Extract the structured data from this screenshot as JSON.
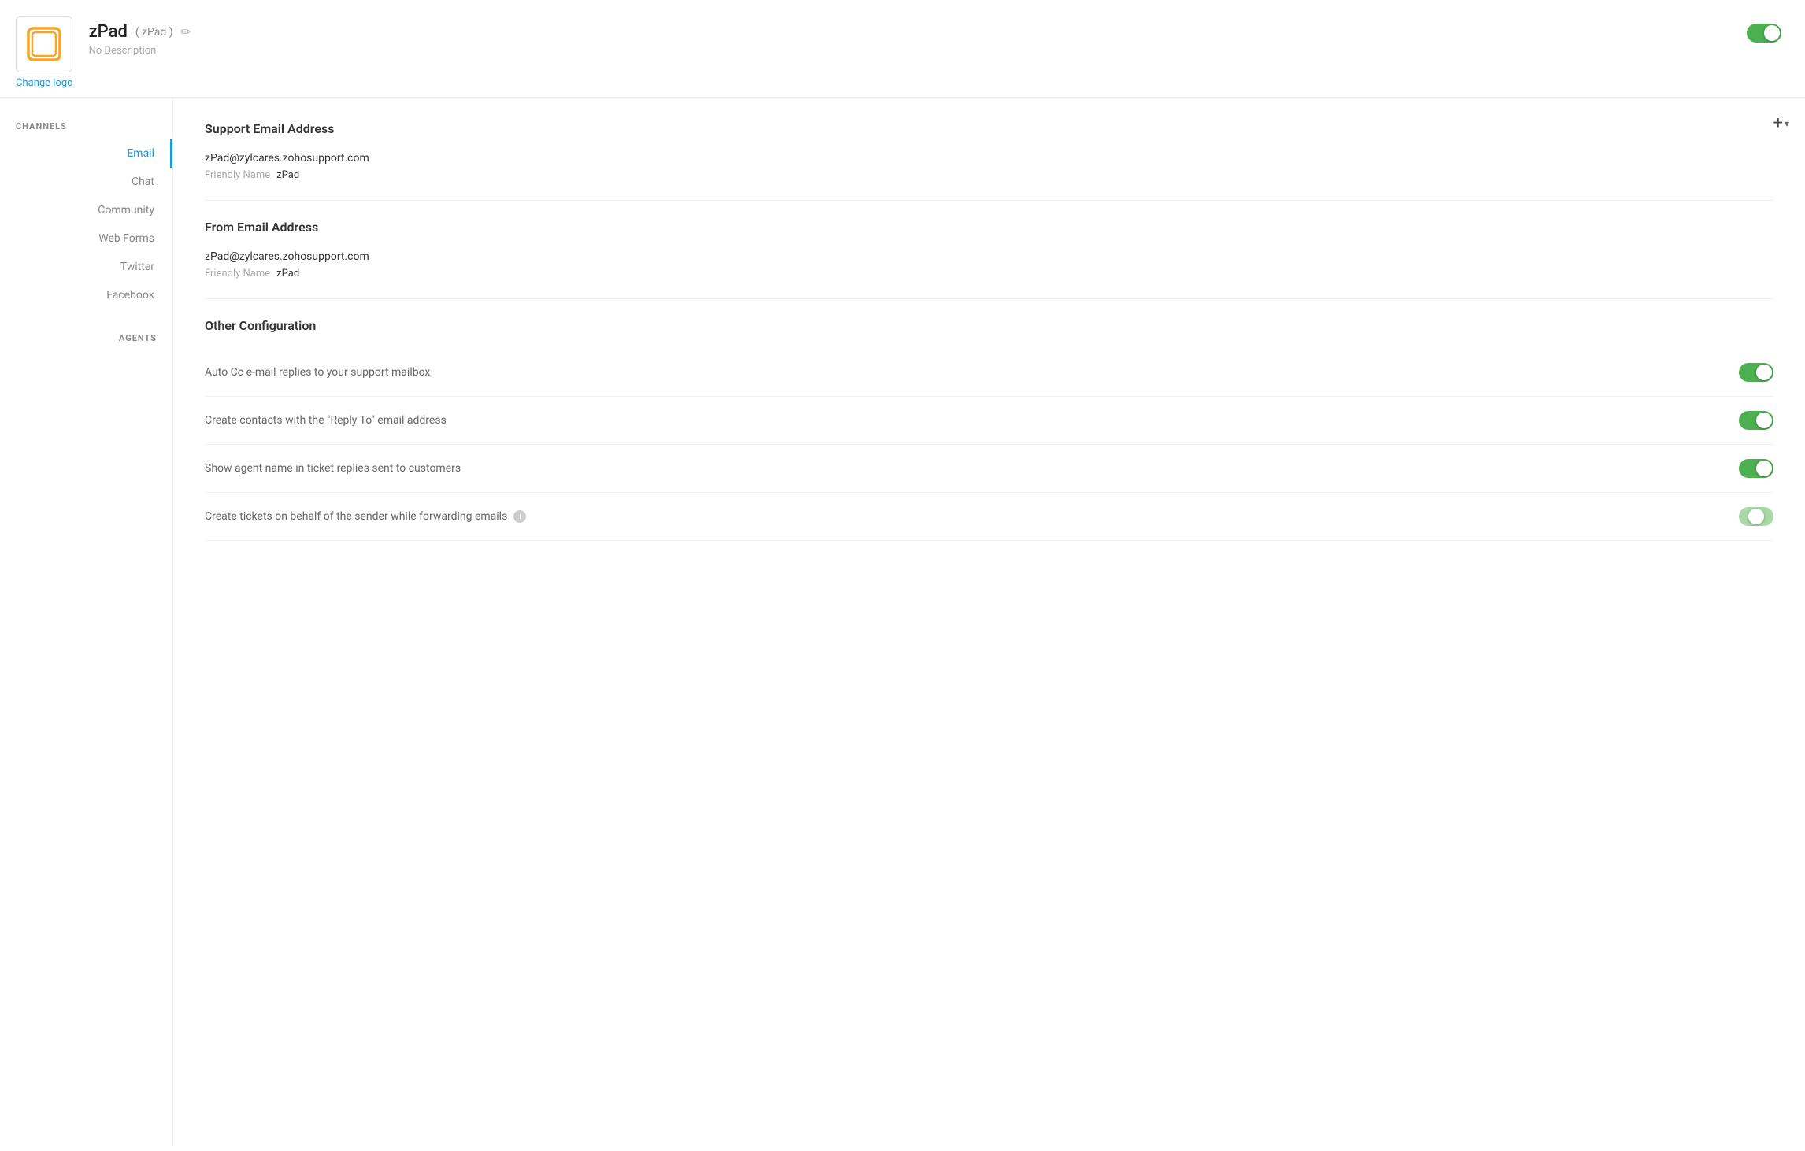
{
  "header": {
    "app_name": "zPad",
    "app_slug": "( zPad )",
    "app_description": "No Description",
    "change_logo_label": "Change logo",
    "main_toggle_state": "on"
  },
  "sidebar": {
    "channels_title": "CHANNELS",
    "agents_title": "AGENTS",
    "items": [
      {
        "id": "email",
        "label": "Email",
        "active": true
      },
      {
        "id": "chat",
        "label": "Chat",
        "active": false
      },
      {
        "id": "community",
        "label": "Community",
        "active": false
      },
      {
        "id": "web-forms",
        "label": "Web Forms",
        "active": false
      },
      {
        "id": "twitter",
        "label": "Twitter",
        "active": false
      },
      {
        "id": "facebook",
        "label": "Facebook",
        "active": false
      }
    ]
  },
  "content": {
    "add_button_label": "+",
    "support_email": {
      "section_title": "Support Email Address",
      "email": "zPad@zylcares.zohosupport.com",
      "friendly_name_label": "Friendly Name",
      "friendly_name_value": "zPad"
    },
    "from_email": {
      "section_title": "From Email Address",
      "email": "zPad@zylcares.zohosupport.com",
      "friendly_name_label": "Friendly Name",
      "friendly_name_value": "zPad"
    },
    "other_config": {
      "section_title": "Other Configuration",
      "items": [
        {
          "id": "auto-cc",
          "label": "Auto Cc e-mail replies to your support mailbox",
          "toggle": "on",
          "has_info": false
        },
        {
          "id": "reply-to",
          "label": "Create contacts with the \"Reply To\" email address",
          "toggle": "on",
          "has_info": false
        },
        {
          "id": "agent-name",
          "label": "Show agent name in ticket replies sent to customers",
          "toggle": "on",
          "has_info": false
        },
        {
          "id": "forward-tickets",
          "label": "Create tickets on behalf of the sender while forwarding emails",
          "toggle": "partial",
          "has_info": true
        }
      ]
    }
  }
}
